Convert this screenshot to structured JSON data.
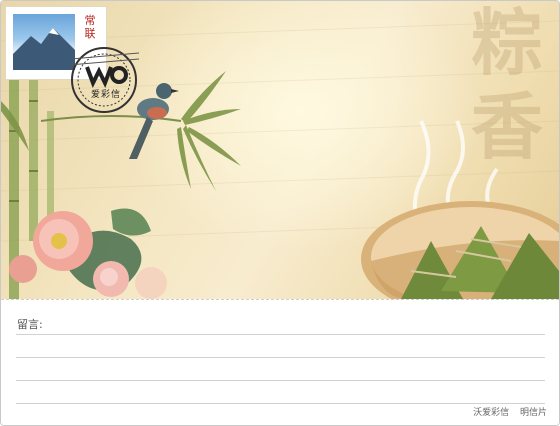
{
  "stamp": {
    "name": "常联"
  },
  "postmark": {
    "brand": "爱彩信"
  },
  "background_text": [
    "粽",
    "香"
  ],
  "message": {
    "label": "留言:"
  },
  "footer": {
    "brand": "沃爱彩信",
    "type": "明信片"
  }
}
